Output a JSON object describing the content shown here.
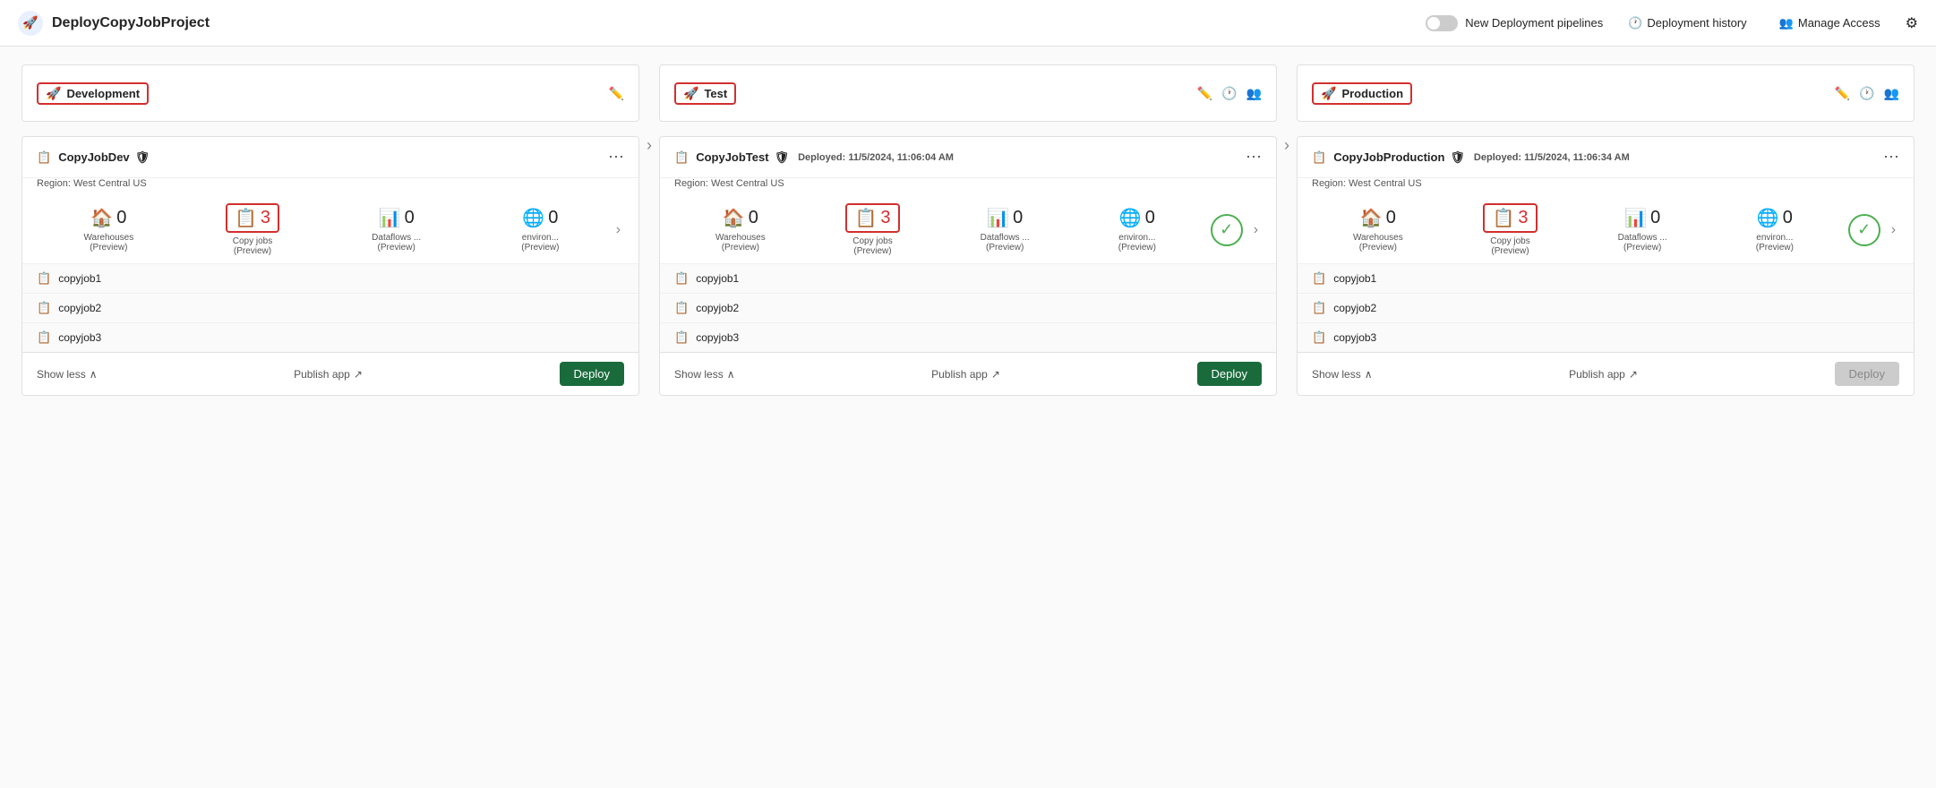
{
  "header": {
    "logo_icon": "🚀",
    "title": "DeployCopyJobProject",
    "toggle_label": "New Deployment pipelines",
    "history_label": "Deployment history",
    "access_label": "Manage Access",
    "gear_icon": "⚙"
  },
  "stages": [
    {
      "id": "development",
      "name": "Development",
      "show_edit": true,
      "show_history": false,
      "show_deploy_access": false,
      "workspace": {
        "name": "CopyJobDev",
        "icon": "📋",
        "deployed": null,
        "region": "Region: West Central US",
        "stats": [
          {
            "icon": "🏠",
            "count": "0",
            "label": "Warehouses\n(Preview)",
            "highlighted": false
          },
          {
            "icon": "📋",
            "count": "3",
            "label": "Copy jobs\n(Preview)",
            "highlighted": true
          },
          {
            "icon": "📊",
            "count": "0",
            "label": "Dataflows ...\n(Preview)",
            "highlighted": false
          },
          {
            "icon": "🌐",
            "count": "0",
            "label": "environ...\n(Preview)",
            "highlighted": false
          }
        ],
        "items": [
          "copyjob1",
          "copyjob2",
          "copyjob3"
        ],
        "show_check": false,
        "footer": {
          "show_less": "Show less",
          "publish": "Publish app",
          "deploy": "Deploy",
          "deploy_disabled": false
        }
      }
    },
    {
      "id": "test",
      "name": "Test",
      "show_edit": true,
      "show_history": true,
      "show_deploy_access": true,
      "workspace": {
        "name": "CopyJobTest",
        "icon": "📋",
        "deployed": "Deployed: 11/5/2024, 11:06:04 AM",
        "region": "Region: West Central US",
        "stats": [
          {
            "icon": "🏠",
            "count": "0",
            "label": "Warehouses\n(Preview)",
            "highlighted": false
          },
          {
            "icon": "📋",
            "count": "3",
            "label": "Copy jobs\n(Preview)",
            "highlighted": true
          },
          {
            "icon": "📊",
            "count": "0",
            "label": "Dataflows ...\n(Preview)",
            "highlighted": false
          },
          {
            "icon": "🌐",
            "count": "0",
            "label": "environ...\n(Preview)",
            "highlighted": false
          }
        ],
        "items": [
          "copyjob1",
          "copyjob2",
          "copyjob3"
        ],
        "show_check": true,
        "footer": {
          "show_less": "Show less",
          "publish": "Publish app",
          "deploy": "Deploy",
          "deploy_disabled": false
        }
      }
    },
    {
      "id": "production",
      "name": "Production",
      "show_edit": true,
      "show_history": true,
      "show_deploy_access": true,
      "workspace": {
        "name": "CopyJobProduction",
        "icon": "📋",
        "deployed": "Deployed: 11/5/2024, 11:06:34 AM",
        "region": "Region: West Central US",
        "stats": [
          {
            "icon": "🏠",
            "count": "0",
            "label": "Warehouses\n(Preview)",
            "highlighted": false
          },
          {
            "icon": "📋",
            "count": "3",
            "label": "Copy jobs\n(Preview)",
            "highlighted": true
          },
          {
            "icon": "📊",
            "count": "0",
            "label": "Dataflows ...\n(Preview)",
            "highlighted": false
          },
          {
            "icon": "🌐",
            "count": "0",
            "label": "environ...\n(Preview)",
            "highlighted": false
          }
        ],
        "items": [
          "copyjob1",
          "copyjob2",
          "copyjob3"
        ],
        "show_check": true,
        "footer": {
          "show_less": "Show less",
          "publish": "Publish app",
          "deploy": "Deploy",
          "deploy_disabled": true
        }
      }
    }
  ]
}
